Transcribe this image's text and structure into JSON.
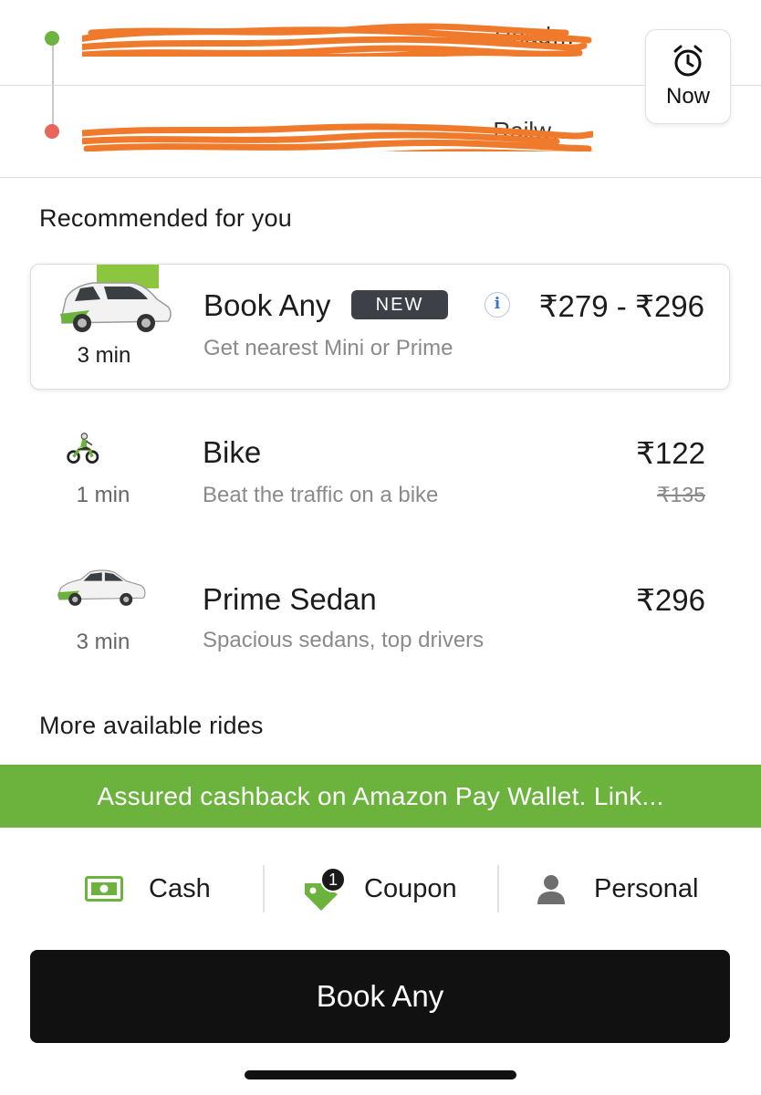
{
  "route": {
    "pickup_address": "…Road…",
    "drop_address": "…Railw…",
    "schedule_label": "Now",
    "schedule_icon": "alarm-clock-icon"
  },
  "recommended": {
    "title": "Recommended for you",
    "rides": [
      {
        "name": "Book Any",
        "badge": "NEW",
        "subtitle": "Get nearest Mini or Prime",
        "price": "₹279 - ₹296",
        "eta": "3 min",
        "icon": "hatchback-car-icon",
        "selected": true
      },
      {
        "name": "Bike",
        "subtitle": "Beat the traffic on a bike",
        "price": "₹122",
        "old_price": "₹135",
        "eta": "1 min",
        "icon": "bike-rider-icon"
      },
      {
        "name": "Prime Sedan",
        "subtitle": "Spacious sedans, top drivers",
        "price": "₹296",
        "eta": "3 min",
        "icon": "sedan-car-icon"
      }
    ]
  },
  "more": {
    "title": "More available rides"
  },
  "banner": {
    "text": "Assured cashback on Amazon Pay Wallet. Link..."
  },
  "payment": {
    "cash_label": "Cash",
    "coupon_label": "Coupon",
    "coupon_count": "1",
    "profile_label": "Personal"
  },
  "cta": {
    "label": "Book Any"
  },
  "colors": {
    "accent_green": "#6bb33d",
    "pickup_dot": "#6cb33f",
    "drop_dot": "#e8665c",
    "cta_bg": "#111111",
    "badge_bg": "#3d4147",
    "redaction": "#f07a2c"
  }
}
